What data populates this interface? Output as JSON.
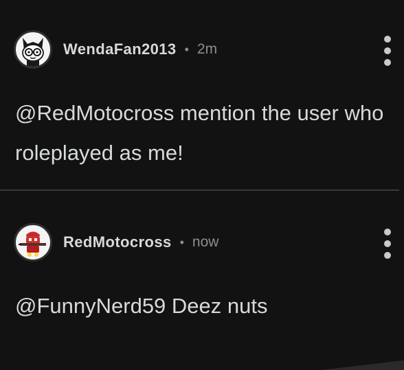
{
  "comments": [
    {
      "username": "WendaFan2013",
      "separator": "•",
      "time": "2m",
      "body": "@RedMotocross mention the user who roleplayed as me!",
      "avatar_icon": "cartoon-face-with-glasses-icon"
    },
    {
      "username": "RedMotocross",
      "separator": "•",
      "time": "now",
      "body": "@FunnyNerd59 Deez nuts",
      "avatar_icon": "red-character-with-rifle-icon"
    }
  ],
  "colors": {
    "background": "#121212",
    "text_primary": "#d7dadc",
    "text_secondary": "#8b8e90",
    "divider": "#3a3a3a"
  }
}
